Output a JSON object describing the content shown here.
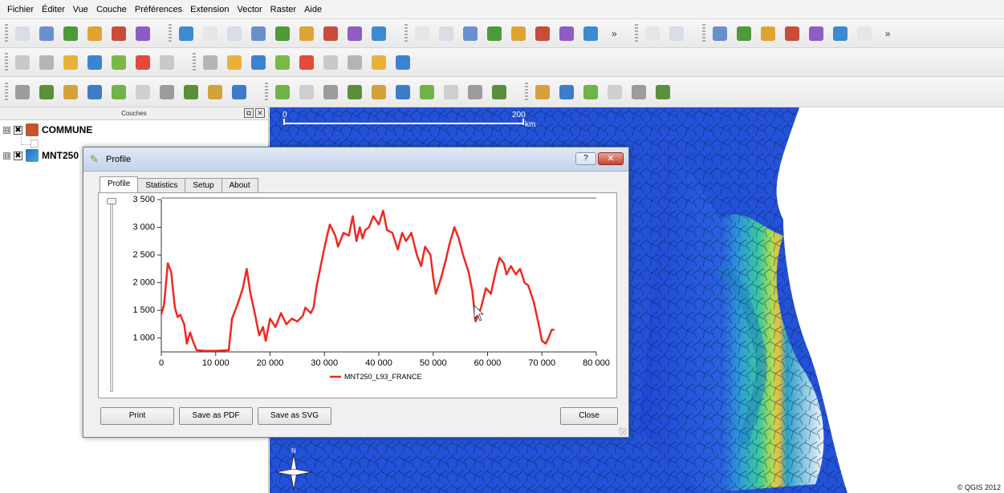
{
  "menubar": [
    "Fichier",
    "Éditer",
    "Vue",
    "Couche",
    "Préférences",
    "Extension",
    "Vector",
    "Raster",
    "Aide"
  ],
  "toolbar_overflow": "»",
  "layers_panel": {
    "title": "Couches",
    "layers": [
      {
        "name": "COMMUNE",
        "checked": "✖",
        "expander": "⊟",
        "symbol_color": "#c3552f"
      },
      {
        "name": "MNT250",
        "checked": "✖",
        "expander": "⊟",
        "symbol_color": "#2f63c8"
      }
    ]
  },
  "map": {
    "scalebar": {
      "start": "0",
      "end": "200",
      "unit": "km"
    },
    "copyright": "© QGIS 2012"
  },
  "dialog": {
    "title": "Profile",
    "help": "?",
    "close_x": "✕",
    "tabs": [
      "Profile",
      "Statistics",
      "Setup",
      "About"
    ],
    "buttons": {
      "print": "Print",
      "save_pdf": "Save as PDF",
      "save_svg": "Save as SVG",
      "close": "Close"
    }
  },
  "chart_data": {
    "type": "line",
    "x_ticks": [
      "0",
      "10 000",
      "20 000",
      "30 000",
      "40 000",
      "50 000",
      "60 000",
      "70 000",
      "80 000"
    ],
    "y_ticks": [
      "1 000",
      "1 500",
      "2 000",
      "2 500",
      "3 000",
      "3 500"
    ],
    "xlim": [
      0,
      80000
    ],
    "ylim": [
      750,
      3500
    ],
    "series": [
      {
        "name": "MNT250_L93_FRANCE",
        "color": "#ee2a1f",
        "points": [
          [
            0,
            1430
          ],
          [
            500,
            1600
          ],
          [
            1200,
            2350
          ],
          [
            1800,
            2200
          ],
          [
            2500,
            1550
          ],
          [
            3000,
            1380
          ],
          [
            3500,
            1420
          ],
          [
            4200,
            1250
          ],
          [
            4700,
            900
          ],
          [
            5300,
            1100
          ],
          [
            5800,
            950
          ],
          [
            6500,
            780
          ],
          [
            8000,
            770
          ],
          [
            10000,
            770
          ],
          [
            12400,
            780
          ],
          [
            13000,
            1350
          ],
          [
            14000,
            1600
          ],
          [
            15000,
            1900
          ],
          [
            15700,
            2250
          ],
          [
            16400,
            1800
          ],
          [
            17200,
            1450
          ],
          [
            18000,
            1050
          ],
          [
            18700,
            1200
          ],
          [
            19200,
            950
          ],
          [
            20000,
            1350
          ],
          [
            21000,
            1200
          ],
          [
            22000,
            1450
          ],
          [
            23000,
            1250
          ],
          [
            24000,
            1350
          ],
          [
            25000,
            1300
          ],
          [
            26000,
            1400
          ],
          [
            26500,
            1550
          ],
          [
            27500,
            1450
          ],
          [
            28000,
            1550
          ],
          [
            28500,
            1900
          ],
          [
            29500,
            2400
          ],
          [
            30500,
            2850
          ],
          [
            31000,
            3050
          ],
          [
            32000,
            2850
          ],
          [
            32500,
            2650
          ],
          [
            33500,
            2900
          ],
          [
            34500,
            2850
          ],
          [
            35200,
            3200
          ],
          [
            35900,
            2750
          ],
          [
            36500,
            3000
          ],
          [
            37000,
            2800
          ],
          [
            37500,
            2950
          ],
          [
            38200,
            3000
          ],
          [
            39000,
            3200
          ],
          [
            40000,
            3050
          ],
          [
            40800,
            3300
          ],
          [
            41500,
            2950
          ],
          [
            42500,
            2900
          ],
          [
            43500,
            2600
          ],
          [
            44300,
            2900
          ],
          [
            45000,
            2750
          ],
          [
            46000,
            2900
          ],
          [
            47000,
            2500
          ],
          [
            47800,
            2300
          ],
          [
            48500,
            2650
          ],
          [
            49500,
            2500
          ],
          [
            50000,
            2100
          ],
          [
            50500,
            1800
          ],
          [
            51500,
            2100
          ],
          [
            52300,
            2400
          ],
          [
            53000,
            2700
          ],
          [
            53900,
            3000
          ],
          [
            54700,
            2800
          ],
          [
            55500,
            2500
          ],
          [
            56500,
            2200
          ],
          [
            57200,
            1850
          ],
          [
            57800,
            1300
          ],
          [
            58800,
            1550
          ],
          [
            59700,
            1900
          ],
          [
            60600,
            1800
          ],
          [
            61500,
            2200
          ],
          [
            62200,
            2450
          ],
          [
            63000,
            2350
          ],
          [
            63500,
            2150
          ],
          [
            64300,
            2300
          ],
          [
            65200,
            2150
          ],
          [
            66000,
            2250
          ],
          [
            66800,
            2000
          ],
          [
            67500,
            1950
          ],
          [
            68500,
            1650
          ],
          [
            69400,
            1250
          ],
          [
            70000,
            950
          ],
          [
            70700,
            900
          ],
          [
            71200,
            1000
          ],
          [
            71800,
            1150
          ],
          [
            72300,
            1150
          ]
        ]
      }
    ]
  }
}
